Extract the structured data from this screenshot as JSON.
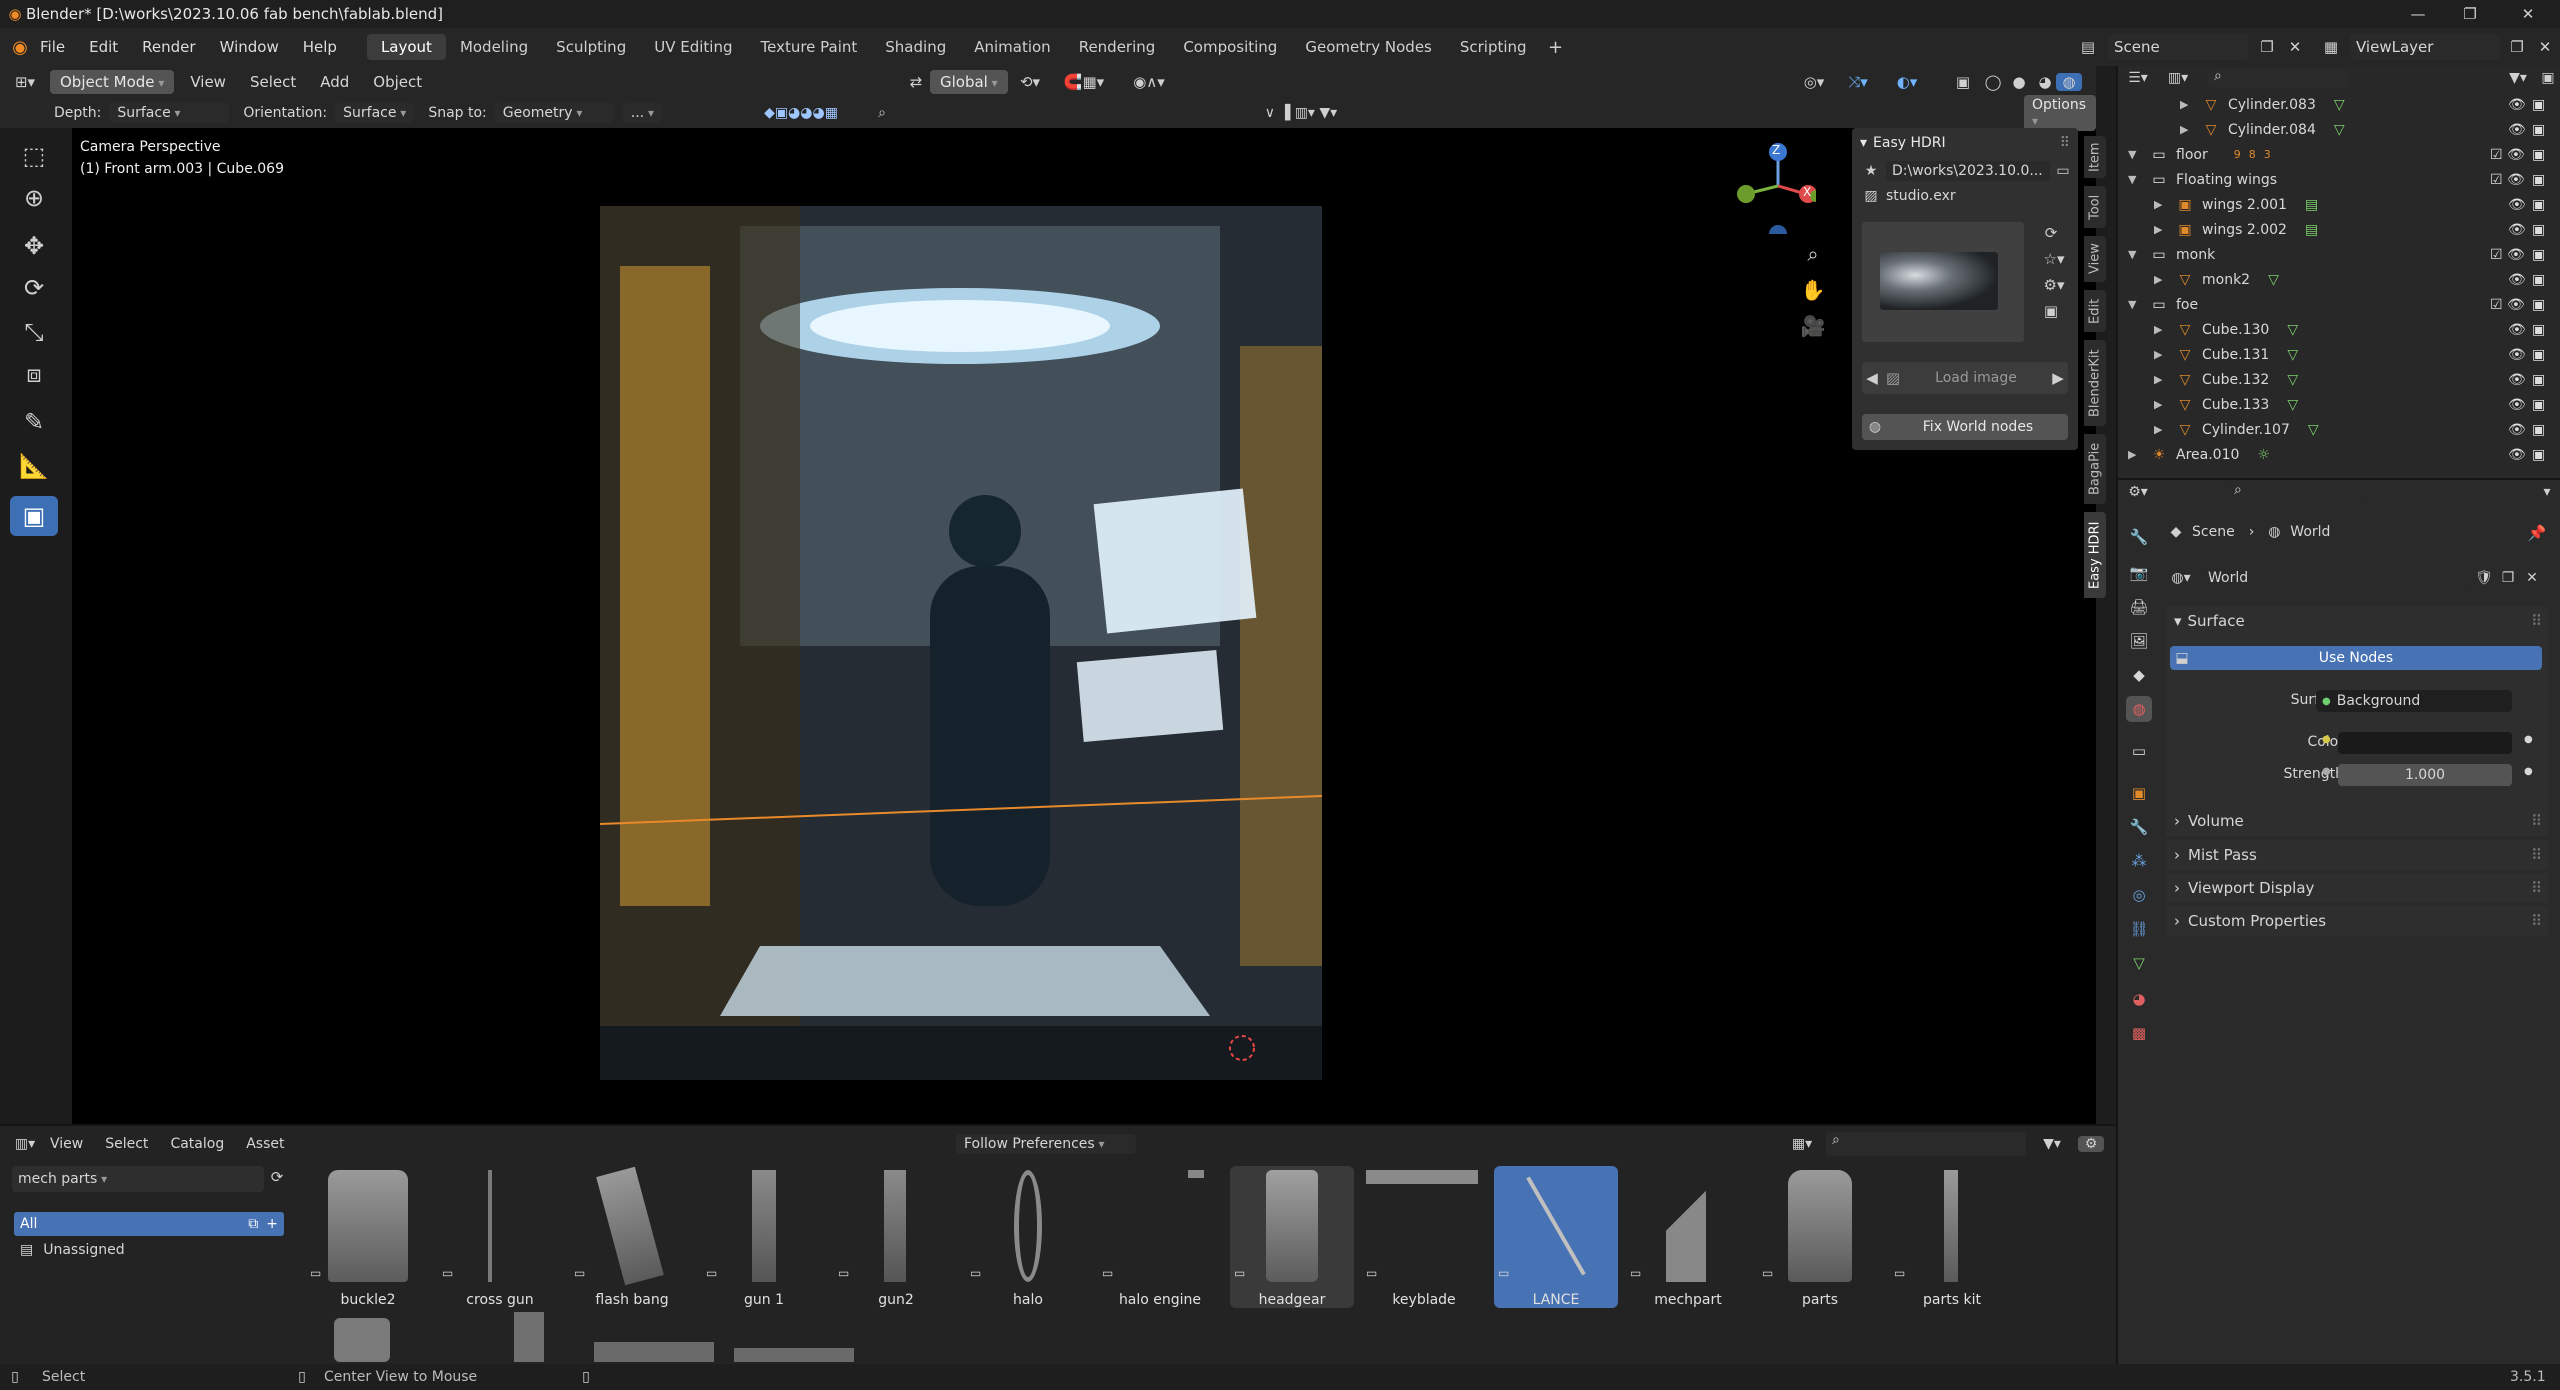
{
  "titlebar": {
    "title": "Blender* [D:\\works\\2023.10.06 fab bench\\fablab.blend]"
  },
  "menubar": {
    "menus": [
      "File",
      "Edit",
      "Render",
      "Window",
      "Help"
    ],
    "workspaces": [
      "Layout",
      "Modeling",
      "Sculpting",
      "UV Editing",
      "Texture Paint",
      "Shading",
      "Animation",
      "Rendering",
      "Compositing",
      "Geometry Nodes",
      "Scripting"
    ],
    "scene": "Scene",
    "viewlayer": "ViewLayer"
  },
  "header": {
    "mode": "Object Mode",
    "menus": [
      "View",
      "Select",
      "Add",
      "Object"
    ],
    "transform": "Global",
    "options": "Options",
    "depth_label": "Depth:",
    "depth_value": "Surface",
    "orientation_label": "Orientation:",
    "orientation_value": "Surface",
    "snap_label": "Snap to:",
    "snap_value": "Geometry",
    "more": "..."
  },
  "viewport": {
    "line1": "Camera Perspective",
    "line2": "(1) Front arm.003 | Cube.069",
    "axis_x": "X",
    "axis_z": "Z"
  },
  "side_tabs": [
    "Item",
    "Tool",
    "View",
    "Edit",
    "BlenderKit",
    "BagaPie",
    "Easy HDRI"
  ],
  "hdri": {
    "title": "Easy HDRI",
    "path": "D:\\works\\2023.10.0...",
    "file": "studio.exr",
    "load": "Load image",
    "fix": "Fix World nodes"
  },
  "asset_browser": {
    "menus": [
      "View",
      "Select",
      "Catalog",
      "Asset"
    ],
    "library": "mech parts",
    "import": "Follow Preferences",
    "catalogs": [
      "All",
      "Unassigned"
    ],
    "items": [
      "buckle2",
      "cross gun",
      "flash bang",
      "gun 1",
      "gun2",
      "halo",
      "halo engine",
      "headgear",
      "keyblade",
      "LANCE",
      "mechpart",
      "parts",
      "parts kit"
    ],
    "selected": "LANCE"
  },
  "outliner": {
    "rows": [
      {
        "name": "Cylinder.083",
        "indent": 3
      },
      {
        "name": "Cylinder.084",
        "indent": 3
      },
      {
        "name": "floor",
        "indent": 1
      },
      {
        "name": "Floating wings",
        "indent": 1
      },
      {
        "name": "wings 2.001",
        "indent": 2
      },
      {
        "name": "wings 2.002",
        "indent": 2
      },
      {
        "name": "monk",
        "indent": 1
      },
      {
        "name": "monk2",
        "indent": 2
      },
      {
        "name": "foe",
        "indent": 1
      },
      {
        "name": "Cube.130",
        "indent": 2
      },
      {
        "name": "Cube.131",
        "indent": 2
      },
      {
        "name": "Cube.132",
        "indent": 2
      },
      {
        "name": "Cube.133",
        "indent": 2
      },
      {
        "name": "Cylinder.107",
        "indent": 2
      },
      {
        "name": "Area.010",
        "indent": 1
      }
    ],
    "floor_badge_a": "9",
    "floor_badge_b": "8",
    "floor_badge_c": "3"
  },
  "properties": {
    "breadcrumb_scene": "Scene",
    "breadcrumb_world": "World",
    "world_name": "World",
    "surface_section": "Surface",
    "use_nodes": "Use Nodes",
    "surface_label": "Surface",
    "surface_value": "Background",
    "color_label": "Color",
    "strength_label": "Strength",
    "strength_value": "1.000",
    "sections": [
      "Volume",
      "Mist Pass",
      "Viewport Display",
      "Custom Properties"
    ]
  },
  "statusbar": {
    "select": "Select",
    "center": "Center View to Mouse",
    "version": "3.5.1"
  }
}
